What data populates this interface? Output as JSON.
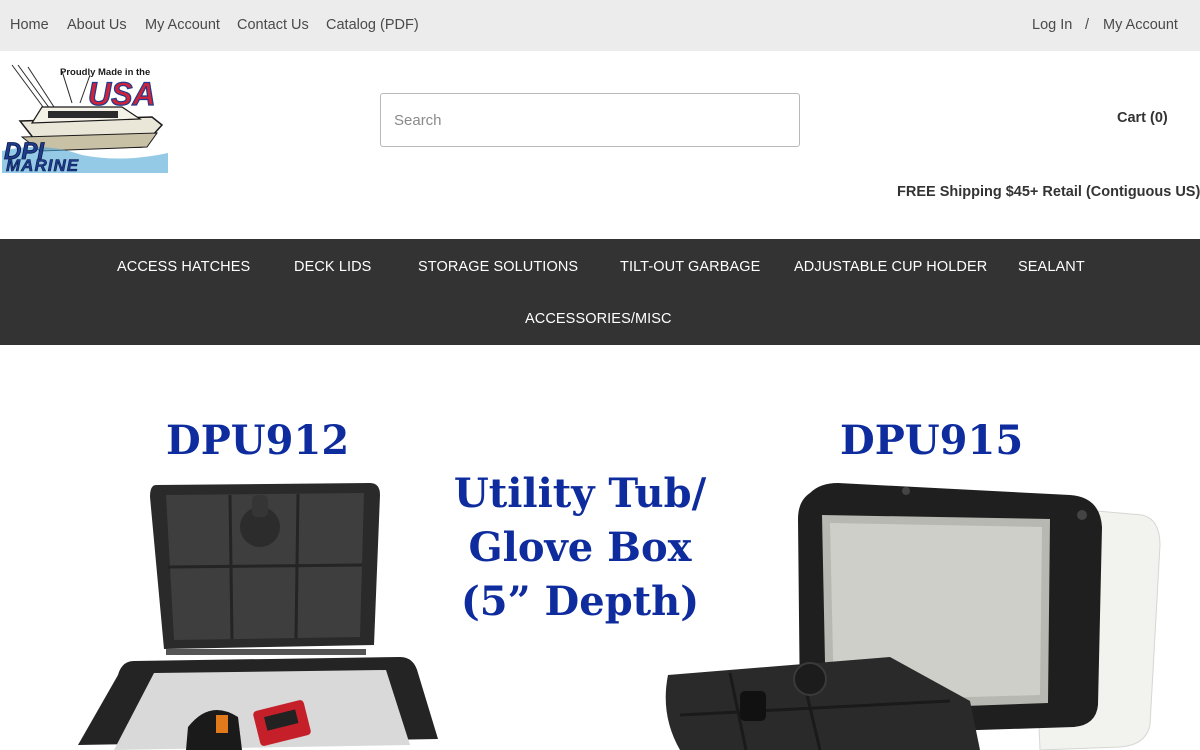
{
  "topbar": {
    "left_links": [
      "Home",
      "About Us",
      "My Account",
      "Contact Us",
      "Catalog (PDF)"
    ],
    "login": "Log In",
    "separator": "/",
    "account": "My Account"
  },
  "header": {
    "logo": {
      "tagline": "Proudly Made in the",
      "country": "USA",
      "brand_line1": "DPI",
      "brand_line2": "MARINE"
    },
    "search": {
      "placeholder": "Search",
      "value": ""
    },
    "cart_label": "Cart (0)",
    "shipping_notice": "FREE Shipping $45+ Retail (Contiguous US)"
  },
  "mainnav": {
    "items": [
      "ACCESS HATCHES",
      "DECK LIDS",
      "STORAGE SOLUTIONS",
      "TILT-OUT GARBAGE",
      "ADJUSTABLE CUP HOLDER",
      "SEALANT",
      "ACCESSORIES/MISC"
    ]
  },
  "zoom": {
    "in_icon": "plus-circle-icon",
    "out_icon": "minus-circle-icon"
  },
  "hero": {
    "left_model": "DPU912",
    "right_model": "DPU915",
    "caption_lines": [
      "Utility Tub/",
      "Glove Box",
      "(5” Depth)"
    ]
  },
  "colors": {
    "topbar_bg": "#ececec",
    "nav_bg": "#333333",
    "hero_text": "#0e2c9e",
    "logo_red": "#d0223a",
    "logo_blue": "#1f3b8c"
  }
}
